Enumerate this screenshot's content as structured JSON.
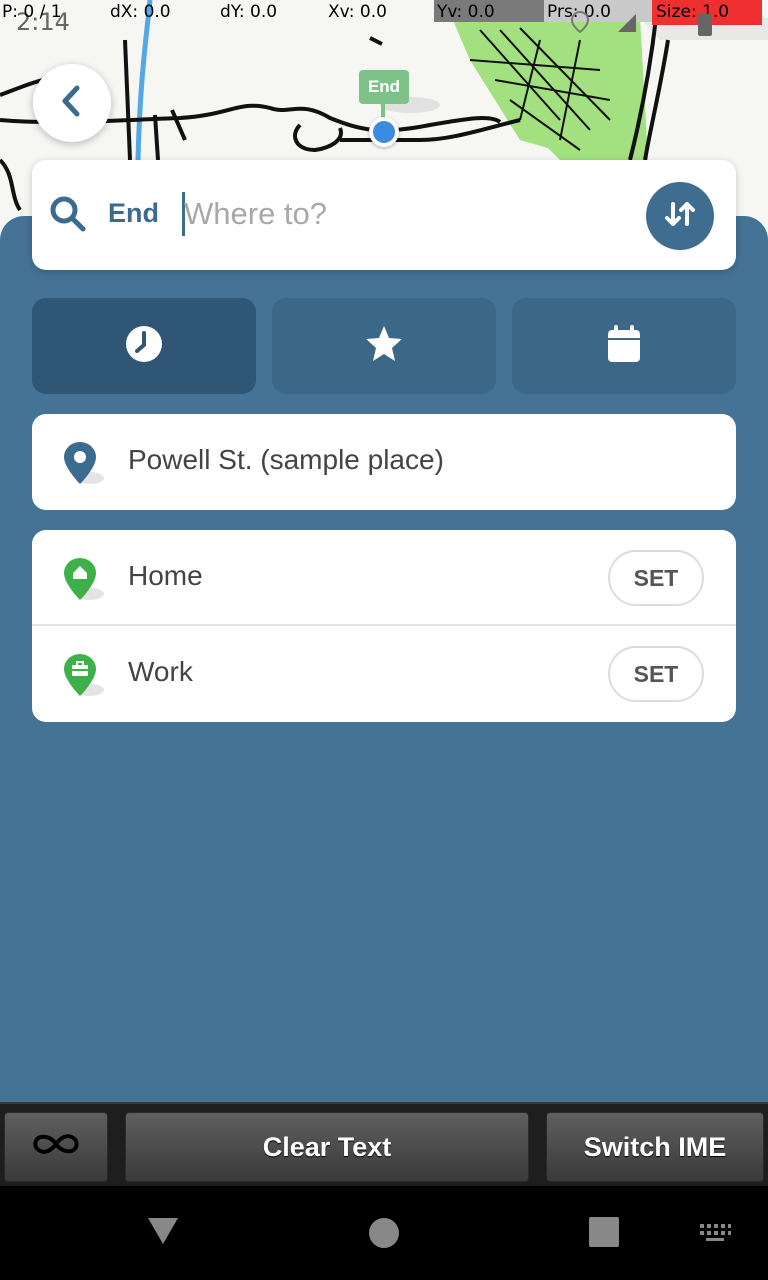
{
  "status_bar": {
    "time": "2:14",
    "debug": {
      "pointer": "P: 0 / 1",
      "dx": "dX: 0.0",
      "dy": "dY: 0.0",
      "xv": "Xv: 0.0",
      "yv": "Yv: 0.0",
      "prs": "Prs: 0.0",
      "size": "Size: 1.0"
    }
  },
  "map": {
    "marker_label": "End",
    "park_color": "#a3e07f",
    "pin_color": "#3d8be0"
  },
  "back_button": {
    "icon": "chevron-left-icon"
  },
  "search": {
    "field_label": "End",
    "placeholder": "Where to?",
    "value": "",
    "search_icon": "search-icon",
    "swap_icon": "swap-vertical-icon"
  },
  "tabs": [
    {
      "name": "recent",
      "icon": "clock-icon",
      "active": true
    },
    {
      "name": "favorites",
      "icon": "star-icon",
      "active": false
    },
    {
      "name": "calendar",
      "icon": "calendar-icon",
      "active": false
    }
  ],
  "recent_places": [
    {
      "label": "Powell St. (sample place)",
      "icon": "location-pin-icon"
    }
  ],
  "saved_places": [
    {
      "label": "Home",
      "icon": "home-pin-icon",
      "action": "SET"
    },
    {
      "label": "Work",
      "icon": "work-pin-icon",
      "action": "SET"
    }
  ],
  "keyboard_toolbar": {
    "infinity_icon": "infinity-icon",
    "clear_text": "Clear Text",
    "switch_ime": "Switch IME"
  },
  "nav_bar": {
    "back_icon": "triangle-back-icon",
    "home_icon": "circle-home-icon",
    "recents_icon": "square-recents-icon",
    "keyboard_icon": "keyboard-icon"
  },
  "colors": {
    "panel": "#447396",
    "accent": "#3b6b8f",
    "pin_green": "#3db04a"
  }
}
